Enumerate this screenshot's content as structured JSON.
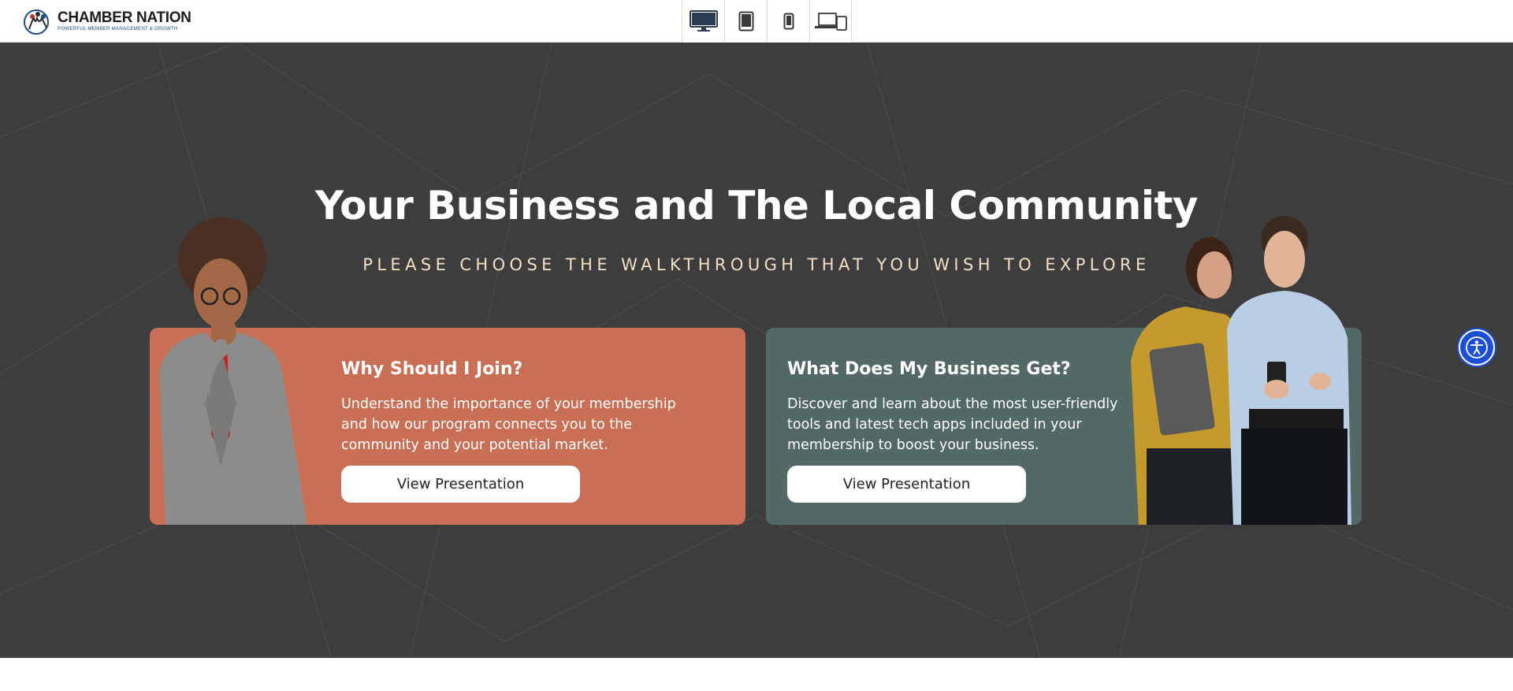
{
  "header": {
    "logo": {
      "name": "CHAMBER NATION",
      "tagline": "POWERFUL MEMBER MANAGEMENT & GROWTH"
    },
    "device_switcher": [
      {
        "icon": "desktop-icon",
        "label": "Desktop"
      },
      {
        "icon": "tablet-icon",
        "label": "Tablet"
      },
      {
        "icon": "mobile-icon",
        "label": "Mobile"
      },
      {
        "icon": "multi-device-icon",
        "label": "All devices"
      }
    ]
  },
  "hero": {
    "title": "Your Business and The Local Community",
    "subtitle": "PLEASE CHOOSE THE WALKTHROUGH THAT YOU WISH TO EXPLORE",
    "cards": [
      {
        "title": "Why Should I Join?",
        "text": "Understand the importance of your membership and how our program connects you to the community and your potential market.",
        "button_label": "View Presentation",
        "color": "#c96f56"
      },
      {
        "title": "What Does My Business Get?",
        "text": "Discover and learn about the  most user-friendly tools and latest tech apps included in your membership to boost your business.",
        "button_label": "View Presentation",
        "color": "#536966"
      }
    ]
  },
  "accessibility": {
    "icon": "accessibility-icon"
  },
  "colors": {
    "hero_bg": "#3d3d3d",
    "subtitle": "#f3dfc1",
    "accent_blue": "#1a4fd6"
  }
}
